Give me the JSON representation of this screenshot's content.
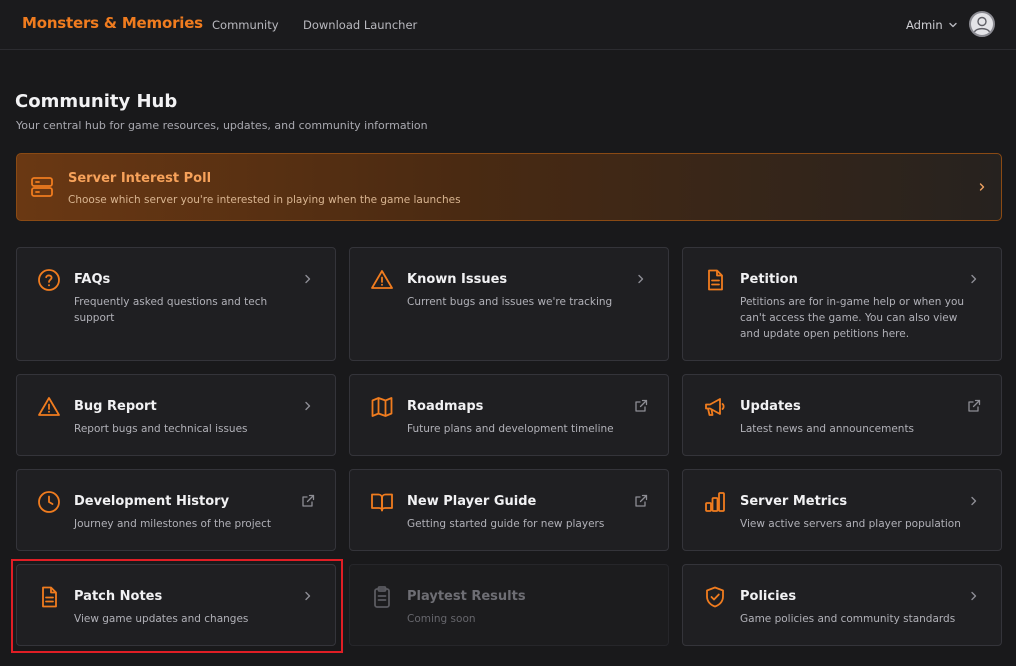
{
  "navbar": {
    "brand": "Monsters & Memories",
    "links": [
      "Community",
      "Download Launcher"
    ],
    "user_label": "Admin"
  },
  "header": {
    "title": "Community Hub",
    "subtitle": "Your central hub for game resources, updates, and community information"
  },
  "poll": {
    "title": "Server Interest Poll",
    "description": "Choose which server you're interested in playing when the game launches"
  },
  "cards": [
    {
      "title": "FAQs",
      "description": "Frequently asked questions and tech support",
      "icon": "help-circle-icon",
      "action": "chevron"
    },
    {
      "title": "Known Issues",
      "description": "Current bugs and issues we're tracking",
      "icon": "warning-triangle-icon",
      "action": "chevron"
    },
    {
      "title": "Petition",
      "description": "Petitions are for in-game help or when you can't access the game. You can also view and update open petitions here.",
      "icon": "document-icon",
      "action": "chevron"
    },
    {
      "title": "Bug Report",
      "description": "Report bugs and technical issues",
      "icon": "warning-triangle-icon",
      "action": "chevron"
    },
    {
      "title": "Roadmaps",
      "description": "Future plans and development timeline",
      "icon": "map-icon",
      "action": "external"
    },
    {
      "title": "Updates",
      "description": "Latest news and announcements",
      "icon": "megaphone-icon",
      "action": "external"
    },
    {
      "title": "Development History",
      "description": "Journey and milestones of the project",
      "icon": "clock-icon",
      "action": "external"
    },
    {
      "title": "New Player Guide",
      "description": "Getting started guide for new players",
      "icon": "book-icon",
      "action": "external"
    },
    {
      "title": "Server Metrics",
      "description": "View active servers and player population",
      "icon": "bar-chart-icon",
      "action": "chevron"
    },
    {
      "title": "Patch Notes",
      "description": "View game updates and changes",
      "icon": "document-icon",
      "action": "chevron"
    },
    {
      "title": "Playtest Results",
      "description": "Coming soon",
      "icon": "clipboard-icon",
      "action": "none",
      "disabled": true
    },
    {
      "title": "Policies",
      "description": "Game policies and community standards",
      "icon": "shield-check-icon",
      "action": "chevron"
    }
  ],
  "colors": {
    "accent": "#f07c1f",
    "background": "#19191b",
    "card": "#1f1f22",
    "highlight": "#e01e25"
  }
}
